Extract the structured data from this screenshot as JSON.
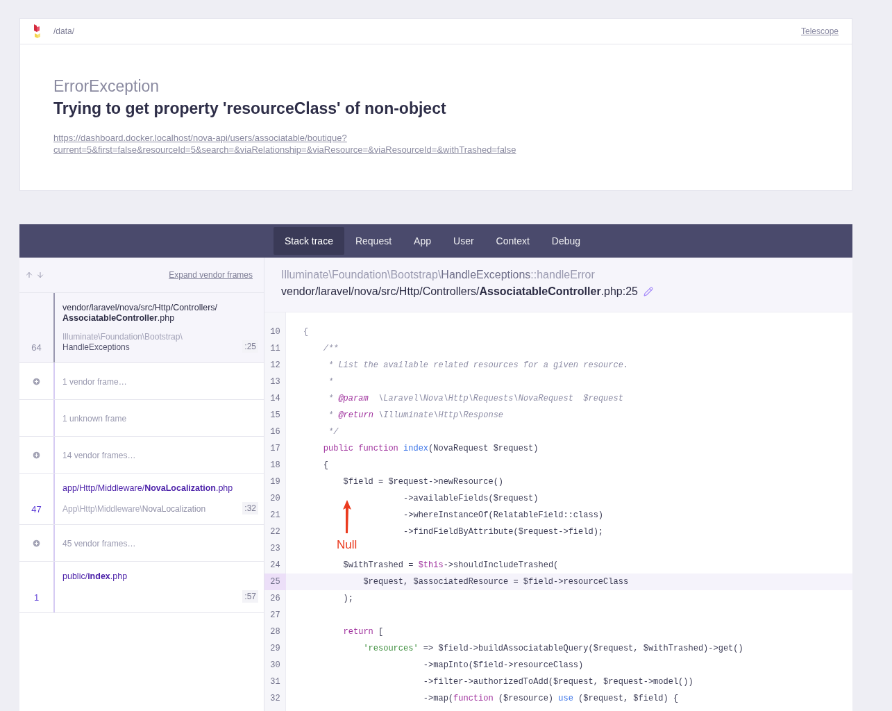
{
  "header": {
    "path": "/data/",
    "link": "Telescope"
  },
  "error": {
    "type": "ErrorException",
    "message": "Trying to get property 'resourceClass' of non-object",
    "url": "https://dashboard.docker.localhost/nova-api/users/associatable/boutique?current=5&first=false&resourceId=5&search=&viaRelationship=&viaResource=&viaResourceId=&withTrashed=false"
  },
  "tabs": [
    {
      "label": "Stack trace",
      "selected": true
    },
    {
      "label": "Request",
      "selected": false
    },
    {
      "label": "App",
      "selected": false
    },
    {
      "label": "User",
      "selected": false
    },
    {
      "label": "Context",
      "selected": false
    },
    {
      "label": "Debug",
      "selected": false
    }
  ],
  "frames_toolbar": {
    "expand_link": "Expand vendor frames"
  },
  "frames": [
    {
      "kind": "frame",
      "selected": true,
      "number": "64",
      "file": "vendor/laravel/nova/src/Http/Controllers/**AssociatableController**.php",
      "namespace": "Illuminate\\Foundation\\Bootstrap\\",
      "class": "HandleExceptions",
      "line": ":25"
    },
    {
      "kind": "vendor_group",
      "selected": false,
      "label": "1 vendor frame…"
    },
    {
      "kind": "unknown",
      "selected": false,
      "label": "1 unknown frame"
    },
    {
      "kind": "vendor_group",
      "selected": false,
      "label": "14 vendor frames…"
    },
    {
      "kind": "frame",
      "selected": false,
      "number": "47",
      "file": "app/Http/Middleware/**NovaLocalization**.php",
      "namespace": "App\\Http\\Middleware\\",
      "class": "NovaLocalization",
      "line": ":32"
    },
    {
      "kind": "vendor_group",
      "selected": false,
      "label": "45 vendor frames…"
    },
    {
      "kind": "frame",
      "selected": false,
      "number": "1",
      "file": "public/**index**.php",
      "line": ":57"
    }
  ],
  "source": {
    "namespace": "Illuminate\\Foundation\\Bootstrap\\",
    "class": "HandleExceptions",
    "method": "::handleError",
    "file": "vendor/laravel/nova/src/Http/Controllers/**AssociatableController**.php:25",
    "annotation": "Null",
    "lines": [
      {
        "number": "10",
        "highlighted": false,
        "tokens": [
          {
            "text": "{",
            "kind": "muted"
          }
        ]
      },
      {
        "number": "11",
        "highlighted": false,
        "tokens": [
          {
            "text": "    /**",
            "kind": "comment"
          }
        ]
      },
      {
        "number": "12",
        "highlighted": false,
        "tokens": [
          {
            "text": "     * List the available related resources for a given resource.",
            "kind": "comment"
          }
        ]
      },
      {
        "number": "13",
        "highlighted": false,
        "tokens": [
          {
            "text": "     *",
            "kind": "comment"
          }
        ]
      },
      {
        "number": "14",
        "highlighted": false,
        "tokens": [
          {
            "text": "     * ",
            "kind": "comment"
          },
          {
            "text": "@param",
            "kind": "doctag"
          },
          {
            "text": "  \\Laravel\\Nova\\Http\\Requests\\NovaRequest  $request",
            "kind": "comment"
          }
        ]
      },
      {
        "number": "15",
        "highlighted": false,
        "tokens": [
          {
            "text": "     * ",
            "kind": "comment"
          },
          {
            "text": "@return",
            "kind": "doctag"
          },
          {
            "text": " \\Illuminate\\Http\\Response",
            "kind": "comment"
          }
        ]
      },
      {
        "number": "16",
        "highlighted": false,
        "tokens": [
          {
            "text": "     */",
            "kind": "comment"
          }
        ]
      },
      {
        "number": "17",
        "highlighted": false,
        "tokens": [
          {
            "text": "    public function ",
            "kind": "keyword"
          },
          {
            "text": "index",
            "kind": "func"
          },
          {
            "text": "(NovaRequest $request)",
            "kind": "plain"
          }
        ]
      },
      {
        "number": "18",
        "highlighted": false,
        "tokens": [
          {
            "text": "    {",
            "kind": "plain"
          }
        ]
      },
      {
        "number": "19",
        "highlighted": false,
        "tokens": [
          {
            "text": "        $field = $request->newResource()",
            "kind": "plain"
          }
        ]
      },
      {
        "number": "20",
        "highlighted": false,
        "tokens": [
          {
            "text": "                    ->availableFields($request)",
            "kind": "plain"
          }
        ]
      },
      {
        "number": "21",
        "highlighted": false,
        "tokens": [
          {
            "text": "                    ->whereInstanceOf(RelatableField::class)",
            "kind": "plain"
          }
        ]
      },
      {
        "number": "22",
        "highlighted": false,
        "tokens": [
          {
            "text": "                    ->findFieldByAttribute($request->field);",
            "kind": "plain"
          }
        ]
      },
      {
        "number": "23",
        "highlighted": false
      },
      {
        "number": "24",
        "highlighted": false,
        "tokens": [
          {
            "text": "        $withTrashed = ",
            "kind": "plain"
          },
          {
            "text": "$this",
            "kind": "keyword"
          },
          {
            "text": "->shouldIncludeTrashed(",
            "kind": "plain"
          }
        ]
      },
      {
        "number": "25",
        "highlighted": true,
        "tokens": [
          {
            "text": "            $request, $associatedResource = $field->resourceClass",
            "kind": "plain"
          }
        ]
      },
      {
        "number": "26",
        "highlighted": false,
        "tokens": [
          {
            "text": "        );",
            "kind": "plain"
          }
        ]
      },
      {
        "number": "27",
        "highlighted": false
      },
      {
        "number": "28",
        "highlighted": false,
        "tokens": [
          {
            "text": "        return",
            "kind": "keyword"
          },
          {
            "text": " [",
            "kind": "plain"
          }
        ]
      },
      {
        "number": "29",
        "highlighted": false,
        "tokens": [
          {
            "text": "            'resources'",
            "kind": "string"
          },
          {
            "text": " => $field->buildAssociatableQuery($request, $withTrashed)->get()",
            "kind": "plain"
          }
        ]
      },
      {
        "number": "30",
        "highlighted": false,
        "tokens": [
          {
            "text": "                        ->mapInto($field->resourceClass)",
            "kind": "plain"
          }
        ]
      },
      {
        "number": "31",
        "highlighted": false,
        "tokens": [
          {
            "text": "                        ->filter->authorizedToAdd($request, $request->model())",
            "kind": "plain"
          }
        ]
      },
      {
        "number": "32",
        "highlighted": false,
        "tokens": [
          {
            "text": "                        ->map(",
            "kind": "plain"
          },
          {
            "text": "function",
            "kind": "keyword"
          },
          {
            "text": " ($resource) ",
            "kind": "plain"
          },
          {
            "text": "use",
            "kind": "func"
          },
          {
            "text": " ($request, $field) {",
            "kind": "plain"
          }
        ]
      }
    ]
  }
}
